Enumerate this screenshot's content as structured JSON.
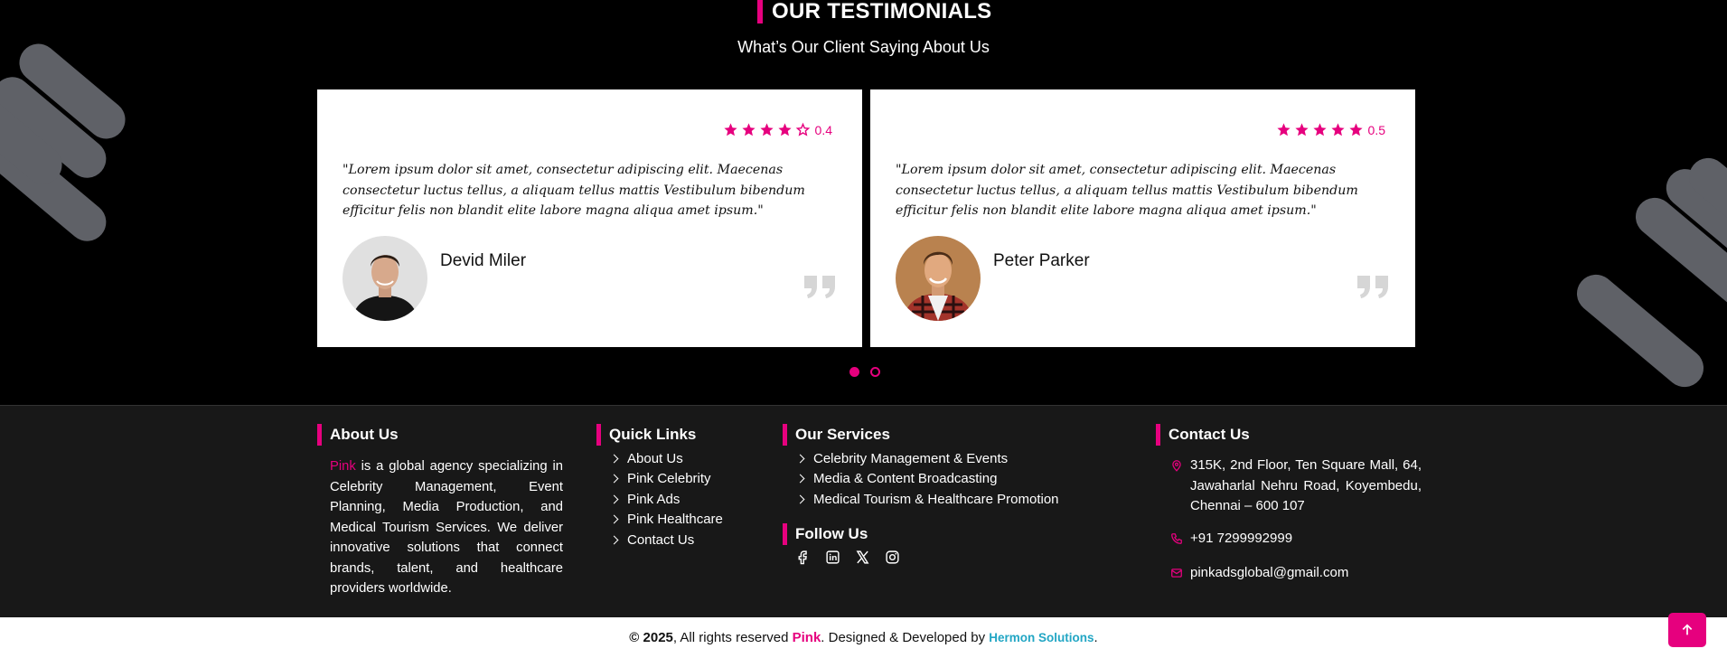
{
  "testimonials": {
    "title": "OUR TESTIMONIALS",
    "subtitle": "What’s Our Client Saying About Us",
    "items": [
      {
        "rating_value": "0.4",
        "stars_filled": 4,
        "stars_total": 5,
        "quote": "\"Lorem ipsum dolor sit amet, consectetur adipiscing elit. Maecenas consectetur luctus tellus, a aliquam tellus mattis Vestibulum bibendum efficitur felis non blandit elite labore magna aliqua amet ipsum.\"",
        "name": "Devid Miler",
        "avatar_icon": "person-avatar"
      },
      {
        "rating_value": "0.5",
        "stars_filled": 5,
        "stars_total": 5,
        "quote": "\"Lorem ipsum dolor sit amet, consectetur adipiscing elit. Maecenas consectetur luctus tellus, a aliquam tellus mattis Vestibulum bibendum efficitur felis non blandit elite labore magna aliqua amet ipsum.\"",
        "name": "Peter Parker",
        "avatar_icon": "person-avatar"
      }
    ],
    "pagination": {
      "current": 1,
      "total": 2
    }
  },
  "footer": {
    "about": {
      "heading": "About Us",
      "brand": "Pink",
      "text": " is a global agency specializing in Celebrity Management, Event Planning, Media Production, and Medical Tourism Services. We deliver innovative solutions that connect brands, talent, and healthcare providers worldwide."
    },
    "quick_links": {
      "heading": "Quick Links",
      "items": [
        "About Us",
        "Pink Celebrity",
        "Pink Ads",
        "Pink Healthcare",
        "Contact Us"
      ]
    },
    "services": {
      "heading": "Our Services",
      "items": [
        "Celebrity Management & Events",
        "Media & Content Broadcasting",
        "Medical Tourism & Healthcare Promotion"
      ]
    },
    "follow": {
      "heading": "Follow Us",
      "icons": [
        "facebook-icon",
        "linkedin-icon",
        "x-icon",
        "instagram-icon"
      ]
    },
    "contact": {
      "heading": "Contact Us",
      "address": "315K, 2nd Floor, Ten Square Mall, 64, Jawaharlal Nehru Road, Koyembedu, Chennai – 600 107",
      "phone": "+91 7299992999",
      "email": "pinkadsglobal@gmail.com"
    }
  },
  "copyright": {
    "symbol_year": "© 2025",
    "text1": ", All rights reserved ",
    "brand": "Pink",
    "text2": ". Designed & Developed by ",
    "developer": "Hermon Solutions",
    "text3": "."
  },
  "colors": {
    "accent": "#e6007e",
    "footer_bg": "#181818",
    "developer": "#22a6c4"
  }
}
